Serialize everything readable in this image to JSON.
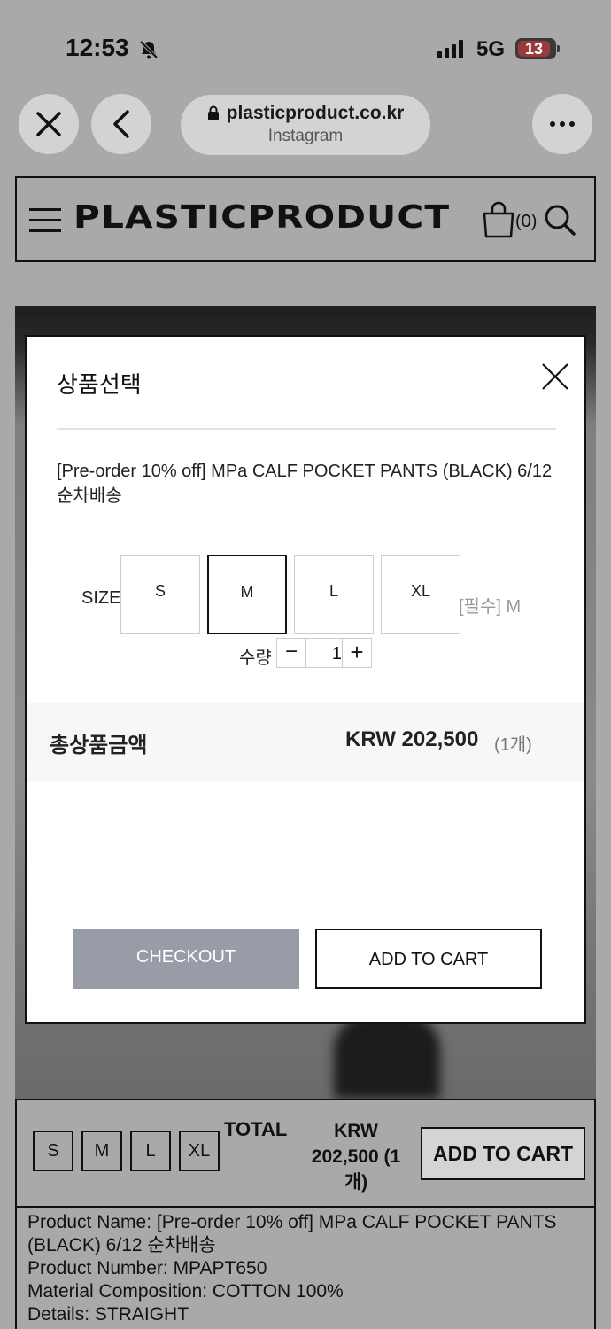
{
  "status_bar": {
    "time": "12:53",
    "network": "5G",
    "battery": "13"
  },
  "browser": {
    "domain": "plasticproduct.co.kr",
    "subtitle": "Instagram"
  },
  "header": {
    "logo": "PLASTICPRODUCT",
    "cart_count": "(0)"
  },
  "modal": {
    "title": "상품선택",
    "product_name": "[Pre-order 10% off] MPa CALF POCKET PANTS (BLACK) 6/12 순차배송",
    "size_label": "SIZE",
    "sizes": [
      "S",
      "M",
      "L",
      "XL"
    ],
    "selected_size": "M",
    "required_note": "[필수] M",
    "quantity_label": "수량",
    "quantity": "1",
    "qty_minus": "−",
    "qty_plus": "+",
    "total_label": "총상품금액",
    "total_amount": "KRW 202,500",
    "total_count": "(1개)",
    "checkout_label": "CHECKOUT",
    "add_to_cart_label": "ADD TO CART"
  },
  "bottom_bar": {
    "sizes": [
      "S",
      "M",
      "L",
      "XL"
    ],
    "total_label": "TOTAL",
    "price": "KRW 202,500 (1 개)",
    "add_to_cart_label": "ADD TO CART"
  },
  "product_info": {
    "name_line": "Product Name: [Pre-order 10% off] MPa CALF POCKET PANTS (BLACK) 6/12 순차배송",
    "number_line": "Product Number: MPAPT650",
    "material_line": "Material Composition: COTTON 100%",
    "details_line": "Details: STRAIGHT"
  },
  "colors": {
    "checkout_bg": "#979ca6",
    "overlay": "#a9a9a9",
    "total_band": "#f7f7f7"
  }
}
